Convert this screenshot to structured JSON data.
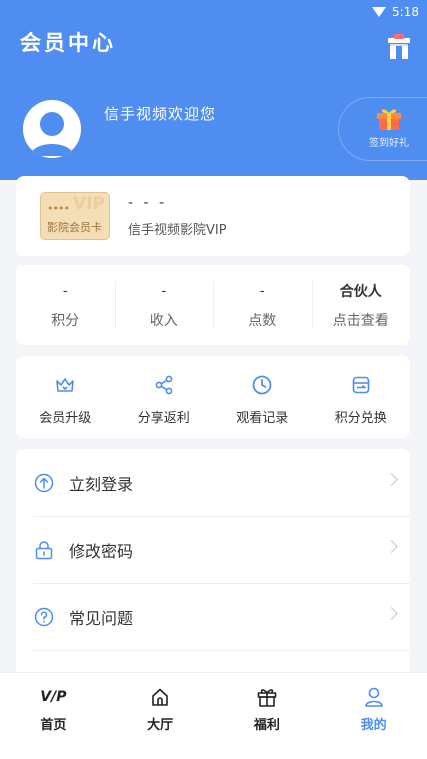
{
  "status": {
    "time": "5:18"
  },
  "header": {
    "title": "会员中心",
    "welcome": "信手视频欢迎您",
    "checkin_label": "签到好礼"
  },
  "vip_card": {
    "badge_word": "VIP",
    "badge_dots": "••••",
    "badge_label": "影院会员卡",
    "title": "- - -",
    "name": "信手视频影院VIP"
  },
  "stats": [
    {
      "value": "-",
      "label": "积分"
    },
    {
      "value": "-",
      "label": "收入"
    },
    {
      "value": "-",
      "label": "点数"
    },
    {
      "value": "合伙人",
      "label": "点击查看"
    }
  ],
  "actions": [
    {
      "label": "会员升级",
      "icon": "crown-icon"
    },
    {
      "label": "分享返利",
      "icon": "share-icon"
    },
    {
      "label": "观看记录",
      "icon": "clock-icon"
    },
    {
      "label": "积分兑换",
      "icon": "exchange-icon"
    }
  ],
  "menu": [
    {
      "label": "立刻登录",
      "icon": "login-icon"
    },
    {
      "label": "修改密码",
      "icon": "lock-icon"
    },
    {
      "label": "常见问题",
      "icon": "question-icon"
    }
  ],
  "tabs": [
    {
      "label": "首页",
      "icon": "vip-logo"
    },
    {
      "label": "大厅",
      "icon": "home-icon"
    },
    {
      "label": "福利",
      "icon": "gift-icon"
    },
    {
      "label": "我的",
      "icon": "user-icon",
      "active": true
    }
  ],
  "colors": {
    "primary": "#4f8df0",
    "background": "#f3f5f8"
  }
}
